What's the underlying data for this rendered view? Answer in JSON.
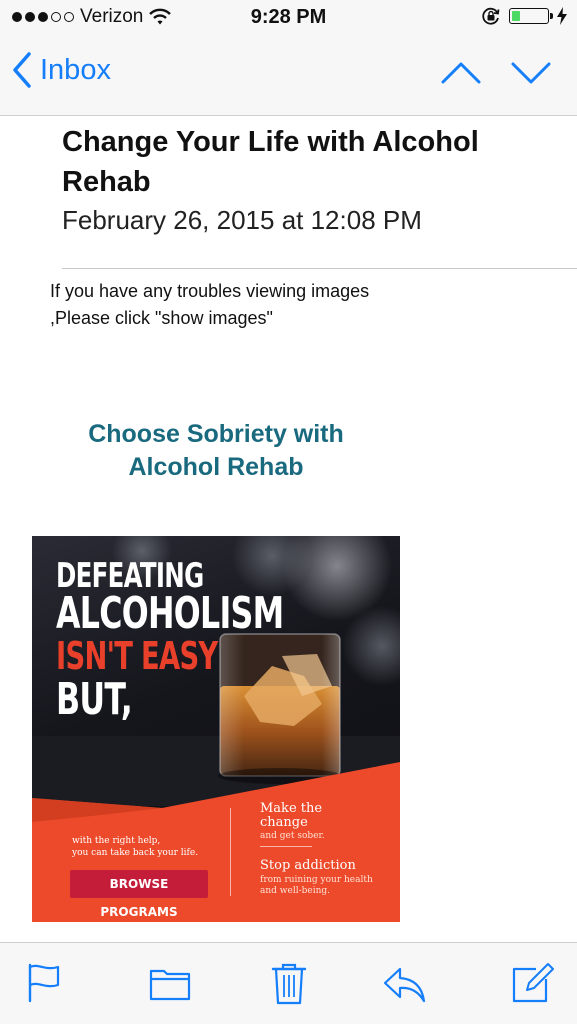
{
  "status_bar": {
    "carrier": "Verizon",
    "time": "9:28 PM",
    "signal_bars_filled": 3,
    "signal_bars_total": 5,
    "battery_level": 0.25
  },
  "nav": {
    "back_label": "Inbox"
  },
  "email": {
    "subject": "Change Your Life with Alcohol Rehab",
    "date": "February 26, 2015 at 12:08 PM",
    "notice": "If you have any troubles viewing images ,Please click \"show images\"",
    "headline_line1": "Choose Sobriety with",
    "headline_line2": "Alcohol Rehab"
  },
  "ad": {
    "line1": "DEFEATING",
    "line2": "ALCOHOLISM",
    "line3": "ISN'T EASY",
    "line4": "BUT,",
    "small_line1": "with the right help,",
    "small_line2": "you can take back your life.",
    "button": "BROWSE PROGRAMS",
    "right1_title_a": "Make the",
    "right1_title_b": "change",
    "right1_sub": "and get sober.",
    "right2_title": "Stop addiction",
    "right2_sub_a": "from ruining your health",
    "right2_sub_b": "and well-being."
  },
  "colors": {
    "accent": "#157efb",
    "headline": "#19697f",
    "ad_orange": "#ec4a2a",
    "ad_button": "#c41d3a",
    "battery": "#4cd964"
  },
  "toolbar": {
    "icons": [
      "flag-icon",
      "folder-icon",
      "trash-icon",
      "reply-icon",
      "compose-icon"
    ]
  }
}
